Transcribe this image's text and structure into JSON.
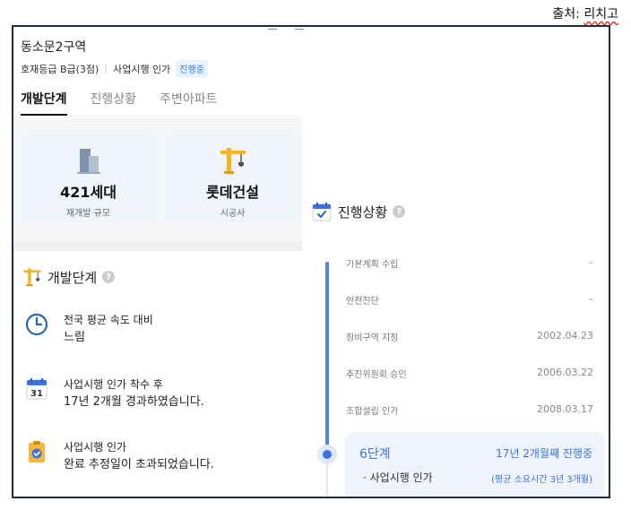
{
  "source": {
    "prefix": "출처: ",
    "name": "리치고"
  },
  "header": {
    "complex_name": "동소문2구역",
    "grade": "호재등급 B급(3점)",
    "stage": "사업시행 인가",
    "badge": "진행중"
  },
  "tabs": [
    {
      "label": "개발단계",
      "active": true
    },
    {
      "label": "진행상황",
      "active": false
    },
    {
      "label": "주변아파트",
      "active": false
    }
  ],
  "cards": [
    {
      "value": "421세대",
      "label": "재개발 규모",
      "icon": "building-icon"
    },
    {
      "value": "롯데건설",
      "label": "시공사",
      "icon": "crane-icon"
    }
  ],
  "dev_stage": {
    "title": "개발단계",
    "items": [
      {
        "icon": "clock-icon",
        "line1": "전국 평균 속도 대비",
        "line2": "느림"
      },
      {
        "icon": "calendar-icon",
        "calendar_day": "31",
        "line1": "사업시행 인가 착수 후",
        "line2": "17년 2개월 경과하였습니다."
      },
      {
        "icon": "clipboard-check-icon",
        "line1": "사업시행 인가",
        "line2": "완료 추정일이 초과되었습니다."
      }
    ]
  },
  "progress": {
    "title": "진행상황",
    "steps": [
      {
        "label": "기본계획 수립",
        "date": "–"
      },
      {
        "label": "안전진단",
        "date": "–"
      },
      {
        "label": "정비구역 지정",
        "date": "2002.04.23"
      },
      {
        "label": "추진위원회 승인",
        "date": "2006.03.22"
      },
      {
        "label": "조합설립 인가",
        "date": "2008.03.17"
      }
    ],
    "current": {
      "stage": "6단계",
      "duration": "17년 2개월째 진행중",
      "name": "· 사업시행 인가",
      "avg": "(평균 소요시간 3년 3개월)"
    }
  },
  "colors": {
    "accent": "#3d73de",
    "badge_bg": "#e8f1ff",
    "crane": "#f2b324"
  }
}
